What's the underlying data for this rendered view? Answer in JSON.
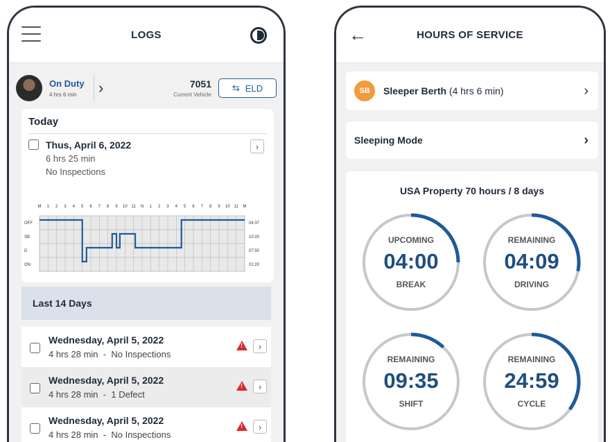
{
  "logs_screen": {
    "title": "LOGS",
    "status": {
      "duty": "On Duty",
      "duty_time": "4 hrs 6 min",
      "vehicle_number": "7051",
      "vehicle_label": "Current Vehicle",
      "eld_button": "ELD"
    },
    "today": {
      "heading": "Today",
      "date": "Thus, April 6, 2022",
      "duration": "6 hrs 25 min",
      "inspections": "No Inspections",
      "graph": {
        "hour_labels": [
          "M",
          "1",
          "2",
          "3",
          "4",
          "5",
          "6",
          "7",
          "8",
          "9",
          "10",
          "11",
          "N",
          "1",
          "2",
          "3",
          "4",
          "5",
          "6",
          "7",
          "8",
          "9",
          "10",
          "11",
          "M"
        ],
        "row_labels": [
          "OFF",
          "SB",
          "D",
          "ON"
        ],
        "row_totals": [
          "04:37",
          "10:20",
          "07:50",
          "01:20"
        ]
      }
    },
    "last14": {
      "heading": "Last 14 Days",
      "rows": [
        {
          "date": "Wednesday, April 5, 2022",
          "duration": "4 hrs 28 min",
          "separator": "-",
          "detail": "No Inspections"
        },
        {
          "date": "Wednesday, April 5, 2022",
          "duration": "4 hrs 28 min",
          "separator": "-",
          "detail": "1 Defect"
        },
        {
          "date": "Wednesday, April 5, 2022",
          "duration": "4 hrs 28 min",
          "separator": "-",
          "detail": "No Inspections"
        }
      ]
    }
  },
  "hos_screen": {
    "title": "HOURS OF SERVICE",
    "sleeper": {
      "badge": "SB",
      "label": "Sleeper Berth",
      "duration": "(4 hrs 6 min)"
    },
    "sleeping_mode": "Sleeping Mode",
    "ruleset": "USA Property 70 hours / 8 days",
    "clocks": [
      {
        "top": "UPCOMING",
        "value": "04:00",
        "bottom": "BREAK",
        "progress": 0.25
      },
      {
        "top": "REMAINING",
        "value": "04:09",
        "bottom": "DRIVING",
        "progress": 0.28
      },
      {
        "top": "REMAINING",
        "value": "09:35",
        "bottom": "SHIFT",
        "progress": 0.12
      },
      {
        "top": "REMAINING",
        "value": "24:59",
        "bottom": "CYCLE",
        "progress": 0.35
      }
    ]
  },
  "colors": {
    "accent": "#1f5a99",
    "clock_value": "#1f4e80",
    "sb_badge": "#f29a3d",
    "warning": "#d9272e",
    "ring_track": "#c5c7cc"
  }
}
